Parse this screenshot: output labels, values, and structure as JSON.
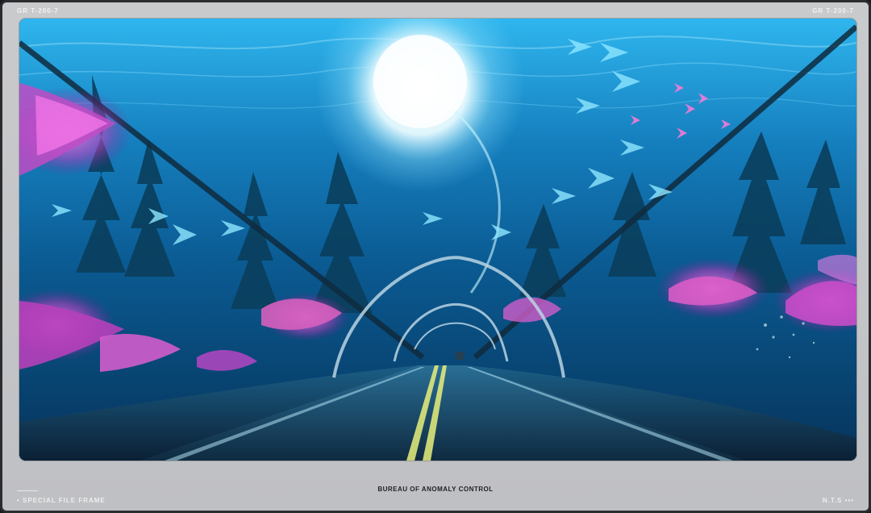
{
  "header": {
    "left_code": "GR   T-200-7",
    "right_code": "GR   T-200-7"
  },
  "caption": "BUREAU OF ANOMALY CONTROL",
  "footer": {
    "left_label": "• SPECIAL FILE FRAME",
    "right_label": "N.T.S •••"
  },
  "colors": {
    "frame_bg": "#c6c7ca",
    "water_top": "#24b6ee",
    "water_mid": "#0a5d97",
    "coral_pink": "#d95cc6",
    "coral_magenta": "#a52ea2",
    "road": "#163a54",
    "lane_line": "#e7f07b"
  },
  "image": {
    "alt": "Underwater glass tunnel with a road, arches, fish, rays, and colorful coral"
  }
}
